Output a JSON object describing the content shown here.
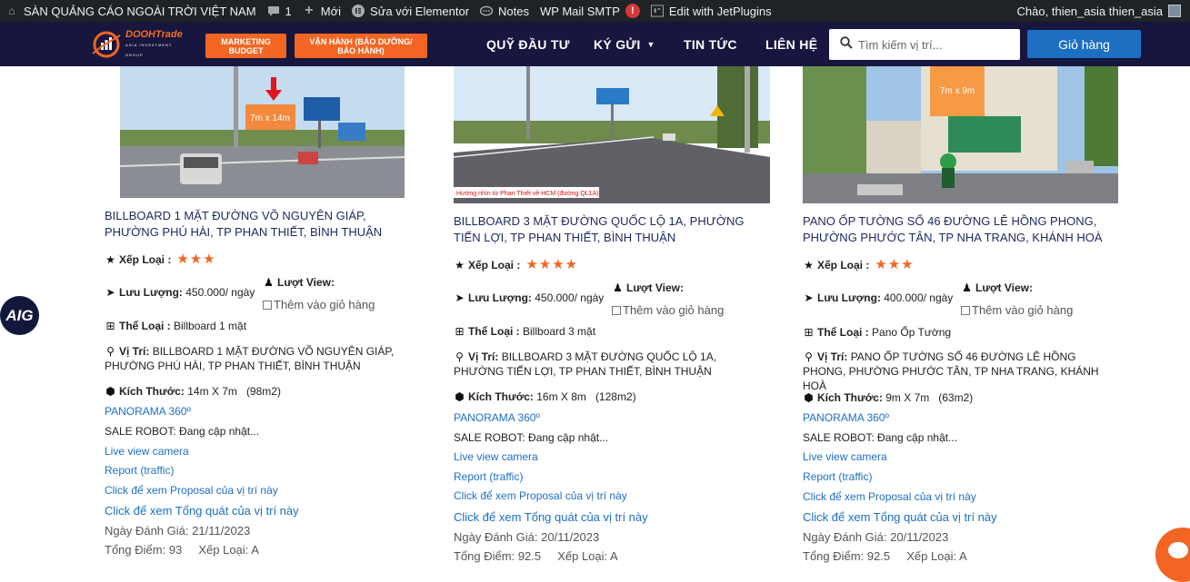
{
  "adminbar": {
    "site": "SÀN QUẢNG CÁO NGOÀI TRỜI VIỆT NAM",
    "comments_count": "1",
    "new_label": "Mới",
    "elementor_label": "Sửa với Elementor",
    "notes_label": "Notes",
    "smtp_label": "WP Mail SMTP",
    "smtp_badge": "!",
    "jetplugins_label": "Edit with JetPlugins",
    "greeting": "Chào, thien_asia thien_asia"
  },
  "header": {
    "logo_text": "DOOHTrade",
    "logo_sub": "ASIA INVESTMENT GROUP",
    "btn_marketing": "MARKETING BUDGET",
    "btn_vanhanh": "VẬN HÀNH (BẢO DƯỠNG/ BẢO HÀNH)",
    "nav": [
      "QUỸ ĐẦU TƯ",
      "KÝ GỬI",
      "TIN TỨC",
      "LIÊN HỆ"
    ],
    "search_placeholder": "Tìm kiếm vị trí...",
    "cart_label": "Giỏ hàng"
  },
  "labels": {
    "rank": "Xếp Loại :",
    "traffic": "Lưu Lượng:",
    "views": "Lượt View:",
    "add_cart": "Thêm vào giỏ hàng",
    "type": "Thể Loại :",
    "location": "Vị Trí:",
    "size": "Kích Thước:",
    "panorama": "PANORAMA 360º",
    "sale_robot": "SALE ROBOT: Đang cập nhật...",
    "live_camera": "Live view camera",
    "report": "Report (traffic)",
    "proposal": "Click để xem Proposal của vị trí này",
    "overview": "Click để xem Tổng quát của vị trí này",
    "eval_date": "Ngày Đánh Giá:",
    "total_score": "Tổng Điểm:",
    "grade": "Xếp Loại:"
  },
  "cards": [
    {
      "title": "BILLBOARD 1 MẶT ĐƯỜNG VÕ NGUYÊN GIÁP, PHƯỜNG PHÚ HÀI, TP PHAN THIẾT, BÌNH THUẬN",
      "stars": "★★★",
      "traffic": "450.000/ ngày",
      "type": "Billboard 1 mặt",
      "location": "BILLBOARD 1 MẶT ĐƯỜNG VÕ NGUYÊN GIÁP, PHƯỜNG PHÚ HÀI, TP PHAN THIẾT, BÌNH THUẬN",
      "size": "14m X 7m",
      "area": "(98m2)",
      "date": "21/11/2023",
      "score": "93",
      "grade": "A",
      "img_label": "7m x 14m"
    },
    {
      "title": "BILLBOARD 3 MẶT ĐƯỜNG QUỐC LỘ 1A, PHƯỜNG TIẾN LỢI, TP PHAN THIẾT, BÌNH THUẬN",
      "stars": "★★★★",
      "traffic": "450.000/ ngày",
      "type": "Billboard 3 mặt",
      "location": "BILLBOARD 3 MẶT ĐƯỜNG QUỐC LỘ 1A, PHƯỜNG TIẾN LỢI, TP PHAN THIẾT, BÌNH THUẬN",
      "size": "16m X 8m",
      "area": "(128m2)",
      "date": "20/11/2023",
      "score": "92.5",
      "grade": "A",
      "img_caption": "Hướng nhìn từ Phan Thiết về HCM (đường QL1A)"
    },
    {
      "title": "PANO ỐP TƯỜNG SỐ 46 ĐƯỜNG LÊ HỒNG PHONG, PHƯỜNG PHƯỚC TÂN, TP NHA TRANG, KHÁNH HOÀ",
      "stars": "★★★",
      "traffic": "400.000/ ngày",
      "type": "Pano Ốp Tường",
      "location": "PANO ỐP TƯỜNG SỐ 46 ĐƯỜNG LÊ HỒNG PHONG, PHƯỜNG PHƯỚC TÂN, TP NHA TRANG, KHÁNH HOÀ",
      "size": "9m X 7m",
      "area": "(63m2)",
      "date": "20/11/2023",
      "score": "92.5",
      "grade": "A",
      "img_label": "7m x 9m"
    }
  ],
  "widgets": {
    "aig": "AIG"
  }
}
